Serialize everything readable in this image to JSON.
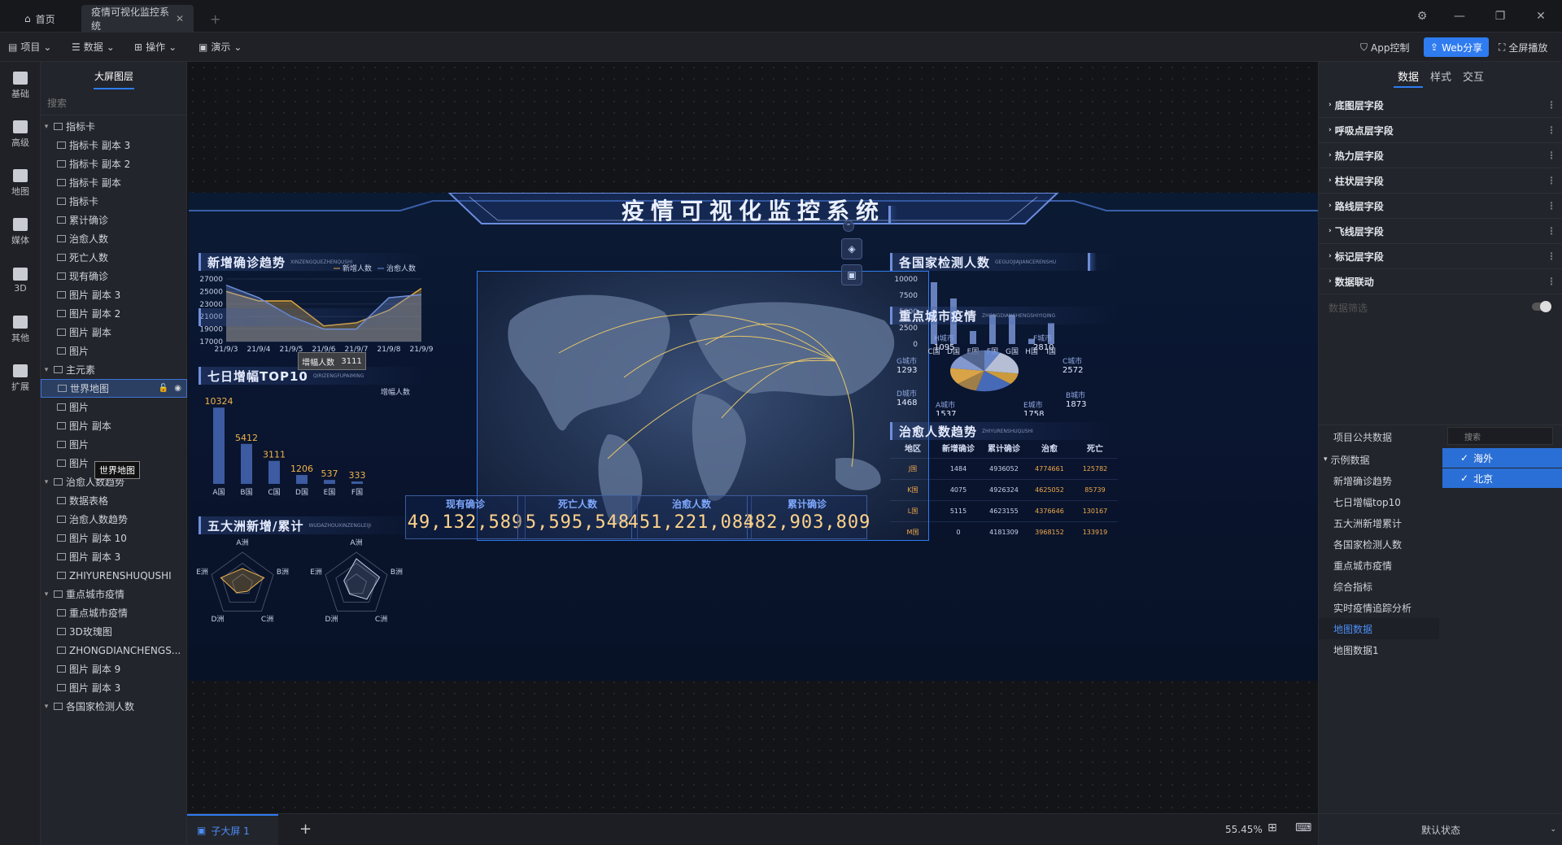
{
  "tabs": {
    "home": "首页",
    "active": "疫情可视化监控系统"
  },
  "menu": {
    "project": "项目",
    "data": "数据",
    "operate": "操作",
    "demo": "演示"
  },
  "toolbar": {
    "app": "App控制",
    "web": "Web分享",
    "fullscreen": "全屏播放"
  },
  "rail": [
    "基础",
    "高级",
    "地图",
    "媒体",
    "3D",
    "其他",
    "扩展"
  ],
  "layers": {
    "title": "大屏图层",
    "search": "搜索",
    "items": [
      {
        "label": "指标卡",
        "group": true
      },
      {
        "label": "指标卡 副本 3"
      },
      {
        "label": "指标卡 副本 2"
      },
      {
        "label": "指标卡 副本"
      },
      {
        "label": "指标卡"
      },
      {
        "label": "累计确诊"
      },
      {
        "label": "治愈人数"
      },
      {
        "label": "死亡人数"
      },
      {
        "label": "现有确诊"
      },
      {
        "label": "图片 副本 3"
      },
      {
        "label": "图片 副本 2"
      },
      {
        "label": "图片 副本"
      },
      {
        "label": "图片"
      },
      {
        "label": "主元素",
        "group": true
      },
      {
        "label": "世界地图",
        "selected": true
      },
      {
        "label": "图片"
      },
      {
        "label": "图片 副本"
      },
      {
        "label": "图片"
      },
      {
        "label": "图片"
      },
      {
        "label": "治愈人数趋势",
        "group": true
      },
      {
        "label": "数据表格"
      },
      {
        "label": "治愈人数趋势"
      },
      {
        "label": "图片 副本 10"
      },
      {
        "label": "图片 副本 3"
      },
      {
        "label": "ZHIYURENSHUQUSHI"
      },
      {
        "label": "重点城市疫情",
        "group": true
      },
      {
        "label": "重点城市疫情"
      },
      {
        "label": "3D玫瑰图"
      },
      {
        "label": "ZHONGDIANCHENGS..."
      },
      {
        "label": "图片 副本 9"
      },
      {
        "label": "图片 副本 3"
      },
      {
        "label": "各国家检测人数",
        "group": true
      }
    ],
    "tooltip": "世界地图"
  },
  "dashboard": {
    "title": "疫情可视化监控系统",
    "panels": {
      "trend": {
        "title": "新增确诊趋势",
        "sub": "XINZENGQUEZHENQUSHI",
        "legend": [
          "新增人数",
          "治愈人数"
        ]
      },
      "top10": {
        "title": "七日增幅TOP10",
        "sub": "QIRIZENGFUPAIMING",
        "legend": "增幅人数",
        "tooltip_label": "增幅人数",
        "tooltip_value": "3111"
      },
      "continent": {
        "title": "五大洲新增/累计",
        "sub": "WUDAZHOUXINZENGLEIJI"
      },
      "tested": {
        "title": "各国家检测人数",
        "sub": "GEGUOJIAJIANCERENSHU"
      },
      "city": {
        "title": "重点城市疫情",
        "sub": "ZHONGDIANCHENGSHIYIQING"
      },
      "cured": {
        "title": "治愈人数趋势",
        "sub": "ZHIYURENSHUQUSHI"
      }
    },
    "kpis": [
      {
        "label": "现有确诊",
        "value": "49,132,589"
      },
      {
        "label": "死亡人数",
        "value": "5,595,548"
      },
      {
        "label": "治愈人数",
        "value": "451,221,083"
      },
      {
        "label": "累计确诊",
        "value": "482,903,809"
      }
    ],
    "table": {
      "headers": [
        "地区",
        "新增确诊",
        "累计确诊",
        "治愈",
        "死亡"
      ],
      "rows": [
        [
          "J国",
          "1484",
          "4936052",
          "4774661",
          "125782"
        ],
        [
          "K国",
          "4075",
          "4926324",
          "4625052",
          "85739"
        ],
        [
          "L国",
          "5115",
          "4623155",
          "4376646",
          "130167"
        ],
        [
          "M国",
          "0",
          "4181309",
          "3968152",
          "133919"
        ]
      ]
    }
  },
  "chart_data": [
    {
      "type": "area",
      "name": "新增确诊趋势",
      "x": [
        "21/9/3",
        "21/9/4",
        "21/9/5",
        "21/9/6",
        "21/9/7",
        "21/9/8",
        "21/9/9"
      ],
      "ylim": [
        17000,
        27000
      ],
      "yticks": [
        27000,
        25000,
        23000,
        21000,
        19000,
        17000
      ],
      "series": [
        {
          "name": "新增人数",
          "values": [
            25000,
            23500,
            23500,
            19500,
            20000,
            22000,
            25500
          ]
        },
        {
          "name": "治愈人数",
          "values": [
            26000,
            24000,
            21000,
            19000,
            19000,
            24000,
            24500
          ]
        }
      ]
    },
    {
      "type": "bar",
      "name": "七日增幅TOP10",
      "categories": [
        "A国",
        "B国",
        "C国",
        "D国",
        "E国",
        "F国"
      ],
      "values": [
        10324,
        5412,
        3111,
        1206,
        537,
        333
      ]
    },
    {
      "type": "radar",
      "name": "五大洲新增",
      "axes": [
        "A洲",
        "B洲",
        "C洲",
        "D洲",
        "E洲"
      ],
      "values": [
        0.5,
        0.7,
        0.25,
        0.3,
        0.7
      ]
    },
    {
      "type": "radar",
      "name": "五大洲累计",
      "axes": [
        "A洲",
        "B洲",
        "C洲",
        "D洲",
        "E洲"
      ],
      "values": [
        0.8,
        0.75,
        0.55,
        0.35,
        0.4
      ]
    },
    {
      "type": "bar",
      "name": "各国家检测人数",
      "categories": [
        "C国",
        "D国",
        "E国",
        "F国",
        "G国",
        "H国",
        "I国"
      ],
      "ylim": [
        0,
        10000
      ],
      "yticks": [
        10000,
        7500,
        5000,
        2500,
        0
      ],
      "values": [
        9500,
        7000,
        2000,
        4500,
        4500,
        800,
        3200
      ]
    },
    {
      "type": "pie",
      "name": "重点城市疫情",
      "labels": [
        "H城市",
        "F城市",
        "G城市",
        "C城市",
        "D城市",
        "B城市",
        "A城市",
        "E城市"
      ],
      "values": [
        1095,
        2810,
        1293,
        2572,
        1468,
        1873,
        1537,
        1758
      ]
    }
  ],
  "right": {
    "tabs": [
      "数据",
      "样式",
      "交互"
    ],
    "fields": [
      "底图层字段",
      "呼吸点层字段",
      "热力层字段",
      "柱状层字段",
      "路线层字段",
      "飞线层字段",
      "标记层字段",
      "数据联动"
    ],
    "filter": "数据筛选",
    "public_title": "项目公共数据",
    "search": "搜索",
    "datasets": [
      "示例数据",
      "新增确诊趋势",
      "七日增幅top10",
      "五大洲新增累计",
      "各国家检测人数",
      "重点城市疫情",
      "综合指标",
      "实时疫情追踪分析",
      "地图数据",
      "地图数据1"
    ],
    "checks": [
      "海外",
      "北京"
    ],
    "state": "默认状态"
  },
  "status": {
    "subscreen": "子大屏 1",
    "zoom": "55.45%"
  }
}
